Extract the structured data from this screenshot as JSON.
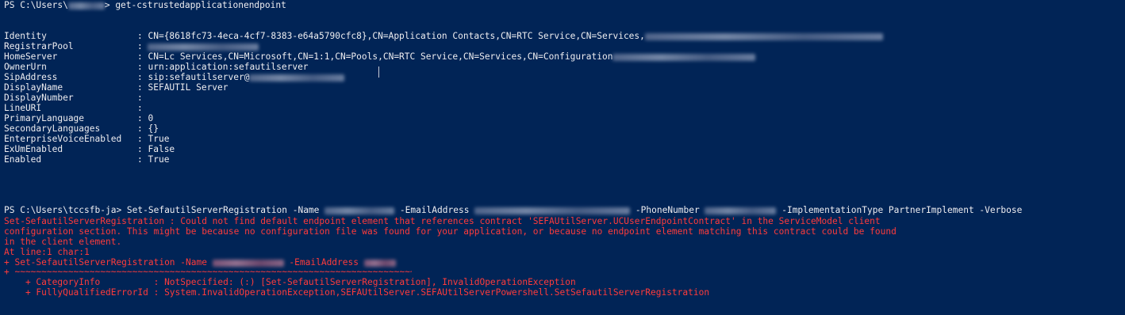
{
  "prompt1": "PS C:\\Users\\",
  "prompt1_end": "> ",
  "cmd1": "get-cstrustedapplicationendpoint",
  "props": [
    {
      "key": "Identity",
      "sep": ": ",
      "value": "CN={8618fc73-4eca-4cf7-8383-e64a5790cfc8},CN=Application Contacts,CN=RTC Service,CN=Services,"
    },
    {
      "key": "RegistrarPool",
      "sep": ": ",
      "value": ""
    },
    {
      "key": "HomeServer",
      "sep": ": ",
      "value": "CN=Lc Services,CN=Microsoft,CN=1:1,CN=Pools,CN=RTC Service,CN=Services,CN=Configuration"
    },
    {
      "key": "OwnerUrn",
      "sep": ": ",
      "value": "urn:application:sefautilserver"
    },
    {
      "key": "SipAddress",
      "sep": ": ",
      "value": "sip:sefautilserver@"
    },
    {
      "key": "DisplayName",
      "sep": ": ",
      "value": "SEFAUTIL Server"
    },
    {
      "key": "DisplayNumber",
      "sep": ":",
      "value": ""
    },
    {
      "key": "LineURI",
      "sep": ":",
      "value": ""
    },
    {
      "key": "PrimaryLanguage",
      "sep": ": ",
      "value": "0"
    },
    {
      "key": "SecondaryLanguages",
      "sep": ": ",
      "value": "{}"
    },
    {
      "key": "EnterpriseVoiceEnabled",
      "sep": ": ",
      "value": "True"
    },
    {
      "key": "ExUmEnabled",
      "sep": ": ",
      "value": "False"
    },
    {
      "key": "Enabled",
      "sep": ": ",
      "value": "True"
    }
  ],
  "prompt2": "PS C:\\Users\\tccsfb-ja> ",
  "cmd2_a": "Set-SefautilServerRegistration -Name ",
  "cmd2_b": " -EmailAddress ",
  "cmd2_c": " -PhoneNumber ",
  "cmd2_d": " -ImplementationType PartnerImplement -Verbose",
  "error_lines": [
    "Set-SefautilServerRegistration : Could not find default endpoint element that references contract 'SEFAUtilServer.UCUserEndpointContract' in the ServiceModel client",
    "configuration section. This might be because no configuration file was found for your application, or because no endpoint element matching this contract could be found",
    "in the client element.",
    "At line:1 char:1"
  ],
  "err_cmd_a": "+ Set-SefautilServerRegistration -Name ",
  "err_cmd_b": " -EmailAddress ",
  "err_underline": "+ ~~~~~~~~~~~~~~~~~~~~~~~~~~~~~~~~~~~~~~~~~~~~~~~~~~~~~~~~~~~~~~~~~~~~~~~~~~~~~~~~~~~~~~~~~~~~~~~~~~~~~~~~~~~~~~~~~~~~~",
  "category_info": "    + CategoryInfo          : NotSpecified: (:) [Set-SefautilServerRegistration], InvalidOperationException",
  "fq_error_id": "    + FullyQualifiedErrorId : System.InvalidOperationException,SEFAUtilServer.SEFAUtilServerPowershell.SetSefautilServerRegistration",
  "colors": {
    "background": "#012456",
    "foreground": "#eeedf0",
    "error": "#ff3b3b"
  }
}
